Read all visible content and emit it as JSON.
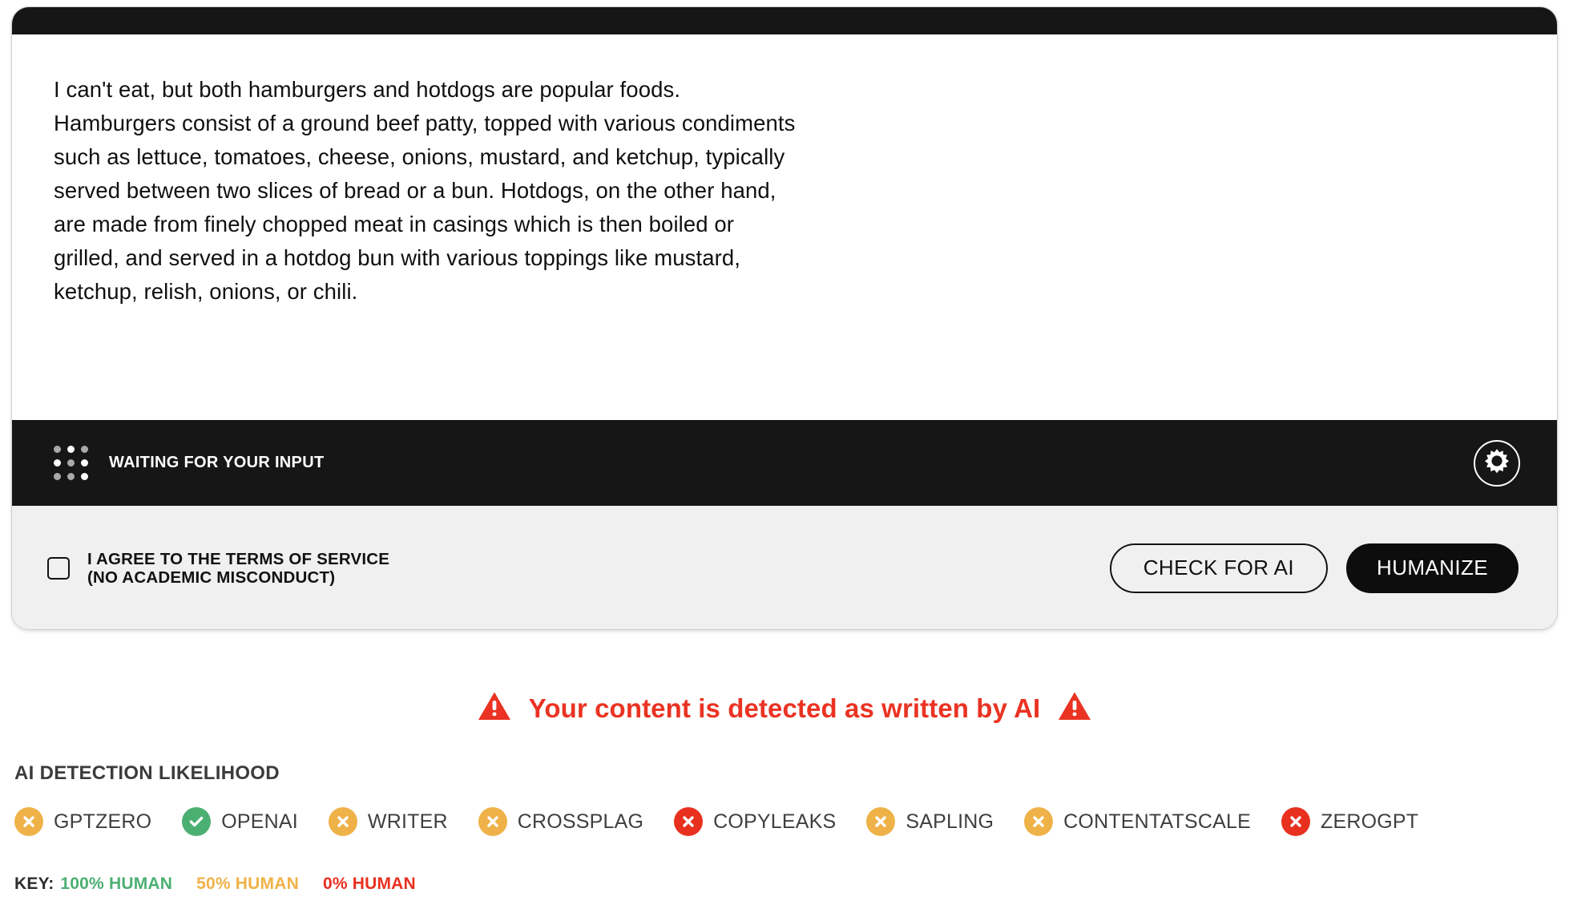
{
  "editor": {
    "body_text": "I can't eat, but both hamburgers and hotdogs are popular foods.\nHamburgers consist of a ground beef patty, topped with various condiments\nsuch as lettuce, tomatoes, cheese, onions, mustard, and ketchup, typically\nserved between two slices of bread or a bun. Hotdogs, on the other hand,\nare made from finely chopped meat in casings which is then boiled or\ngrilled, and served in a hotdog bun with various toppings like mustard,\nketchup, relish, onions, or chili."
  },
  "status": {
    "label": "WAITING FOR\nYOUR INPUT",
    "grid_icon": "dot-grid-icon",
    "settings_icon": "gear-icon"
  },
  "footer": {
    "agree_text": "I AGREE TO THE TERMS OF SERVICE\n(NO ACADEMIC MISCONDUCT)",
    "checkbox_checked": false,
    "check_button": "CHECK FOR AI",
    "humanize_button": "HUMANIZE"
  },
  "results": {
    "alert_text": "Your content is detected as written by AI",
    "alert_icon": "warning-triangle-icon",
    "section_title": "AI DETECTION LIKELIHOOD",
    "badges": [
      {
        "label": "GPTZERO",
        "state": "fail",
        "icon": "x-circle-icon",
        "color": "#EFB248"
      },
      {
        "label": "OPENAI",
        "state": "pass",
        "icon": "check-circle-icon",
        "color": "#4CAF72"
      },
      {
        "label": "WRITER",
        "state": "fail",
        "icon": "x-circle-icon",
        "color": "#EFB248"
      },
      {
        "label": "CROSSPLAG",
        "state": "fail",
        "icon": "x-circle-icon",
        "color": "#EFB248"
      },
      {
        "label": "COPYLEAKS",
        "state": "alert",
        "icon": "x-circle-icon",
        "color": "#E8301F"
      },
      {
        "label": "SAPLING",
        "state": "fail",
        "icon": "x-circle-icon",
        "color": "#EFB248"
      },
      {
        "label": "CONTENTATSCALE",
        "state": "fail",
        "icon": "x-circle-icon",
        "color": "#EFB248"
      },
      {
        "label": "ZEROGPT",
        "state": "alert",
        "icon": "x-circle-icon",
        "color": "#E8301F"
      }
    ],
    "key": {
      "label": "KEY:",
      "items": [
        {
          "text": "100% HUMAN",
          "color": "#4CAF72"
        },
        {
          "text": "50% HUMAN",
          "color": "#EFB248"
        },
        {
          "text": "0% HUMAN",
          "color": "#E8301F"
        }
      ]
    }
  },
  "colors": {
    "dark": "#161616",
    "footer_bg": "#f0f0f0",
    "alert_red": "#ea3323"
  }
}
